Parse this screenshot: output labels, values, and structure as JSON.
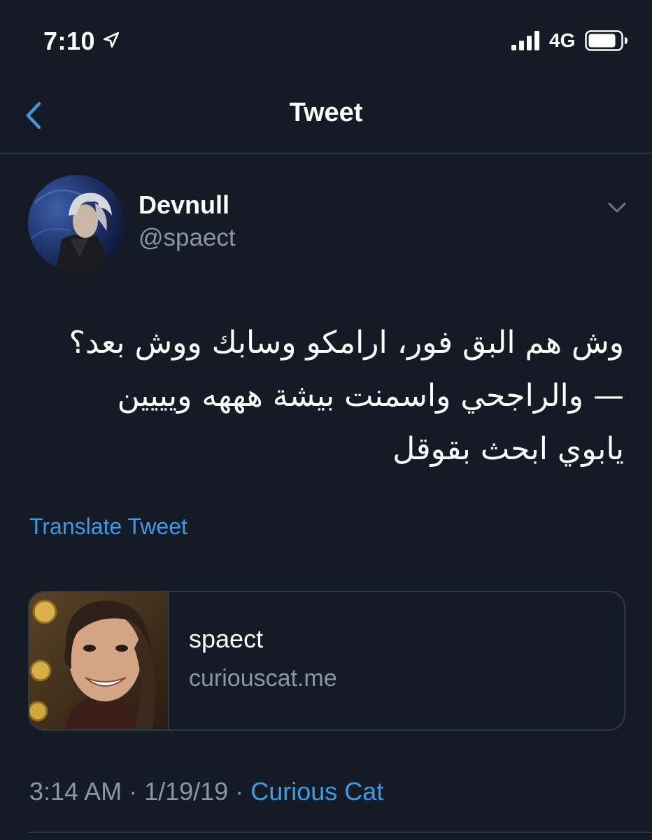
{
  "status_bar": {
    "time": "7:10",
    "network": "4G",
    "icons": [
      "location-arrow-icon",
      "cellular-signal-icon",
      "battery-icon"
    ]
  },
  "nav": {
    "title": "Tweet",
    "back_icon": "chevron-left-icon"
  },
  "author": {
    "display_name": "Devnull",
    "handle": "@spaect",
    "avatar": "avatar-silver-haired-character",
    "menu_icon": "chevron-down-icon"
  },
  "tweet": {
    "lines": [
      "وش هم البق فور، ارامكو وسابك ووش بعد؟",
      "— والراجحي واسمنت بيشة هههه ويييين",
      "يابوي ابحث بقوقل"
    ],
    "translate_label": "Translate Tweet"
  },
  "card": {
    "title": "spaect",
    "domain": "curiouscat.me",
    "image": "smiling-character-with-coins"
  },
  "meta": {
    "time": "3:14 AM",
    "separator_1": " · ",
    "date": "1/19/19",
    "separator_2": " · ",
    "source": "Curious Cat"
  },
  "colors": {
    "background": "#141b25",
    "accent": "#3f9ae6",
    "secondary_text": "#8a96a4",
    "divider": "#2b3440"
  }
}
